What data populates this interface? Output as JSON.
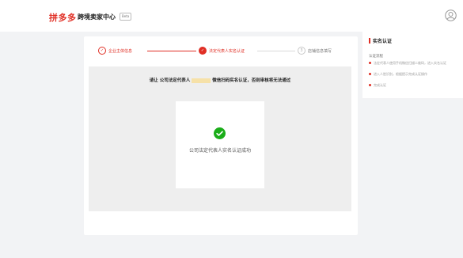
{
  "header": {
    "logo": "拼多多",
    "title": "跨境卖家中心",
    "badge": "Beta"
  },
  "steps": [
    {
      "number": "✓",
      "label": "企业主体信息",
      "status": "done"
    },
    {
      "number": "✓",
      "label": "法定代表人实名认证",
      "status": "current"
    },
    {
      "number": "3",
      "label": "店铺信息填写",
      "status": "pending"
    }
  ],
  "verification": {
    "instruction_before": "请让 公司法定代表人",
    "instruction_after": "微信扫码实名认证，否则审核将无法通过",
    "success_text": "公司法定代表人实名认证成功"
  },
  "side_panel": {
    "title": "实名认证",
    "subtitle": "认证流程",
    "items": [
      "法定代表人使用手机微信扫描二维码，进入实名认证",
      "进入人脸识别，根据提示完成认证操作",
      "完成认证"
    ]
  },
  "colors": {
    "accent": "#e02e24",
    "success": "#1aad19"
  }
}
